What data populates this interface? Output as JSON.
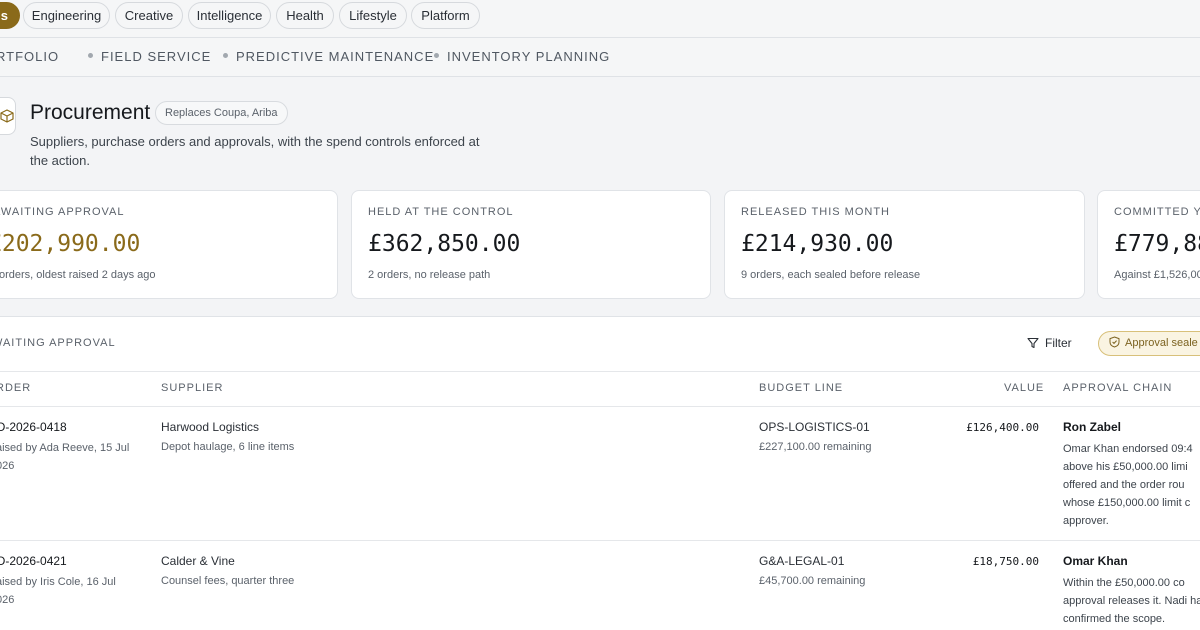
{
  "categories": [
    {
      "label": "s",
      "active": true
    },
    {
      "label": "Engineering"
    },
    {
      "label": "Creative"
    },
    {
      "label": "Intelligence"
    },
    {
      "label": "Health"
    },
    {
      "label": "Lifestyle"
    },
    {
      "label": "Platform"
    }
  ],
  "subnav": [
    "RTFOLIO",
    "FIELD SERVICE",
    "PREDICTIVE MAINTENANCE",
    "INVENTORY PLANNING"
  ],
  "header": {
    "icon": "box-icon",
    "title": "Procurement",
    "badge": "Replaces Coupa, Ariba",
    "description": "Suppliers, purchase orders and approvals, with the spend controls enforced at the action."
  },
  "stats": [
    {
      "label": "AWAITING APPROVAL",
      "value": "£202,990.00",
      "sub": "orders, oldest raised 2 days ago",
      "accent": "#8a6a1a"
    },
    {
      "label": "HELD AT THE CONTROL",
      "value": "£362,850.00",
      "sub": "2 orders, no release path"
    },
    {
      "label": "RELEASED THIS MONTH",
      "value": "£214,930.00",
      "sub": "9 orders, each sealed before release"
    },
    {
      "label": "COMMITTED YE",
      "value": "£779,88",
      "sub": "Against £1,526,00"
    }
  ],
  "table": {
    "title": "WAITING APPROVAL",
    "filter_label": "Filter",
    "seal_label": "Approval seale",
    "columns": {
      "order": "RDER",
      "supplier": "SUPPLIER",
      "budget": "BUDGET LINE",
      "value": "VALUE",
      "chain": "APPROVAL CHAIN"
    },
    "rows": [
      {
        "order": "O-2026-0418",
        "raised": "aised by Ada Reeve, 15 Jul 026",
        "supplier": "Harwood Logistics",
        "supplier_detail": "Depot haulage, 6 line items",
        "budget": "OPS-LOGISTICS-01",
        "remaining": "£227,100.00 remaining",
        "value": "£126,400.00",
        "approver": "Ron Zabel",
        "chain_note": "Omar Khan endorsed 09:4 above his £50,000.00 limi offered and the order rou whose £150,000.00 limit c approver."
      },
      {
        "order": "O-2026-0421",
        "raised": "aised by Iris Cole, 16 Jul 026",
        "supplier": "Calder & Vine",
        "supplier_detail": "Counsel fees, quarter three",
        "budget": "G&A-LEGAL-01",
        "remaining": "£45,700.00 remaining",
        "value": "£18,750.00",
        "approver": "Omar Khan",
        "chain_note": "Within the £50,000.00 co approval releases it. Nadi has confirmed the scope."
      }
    ]
  }
}
